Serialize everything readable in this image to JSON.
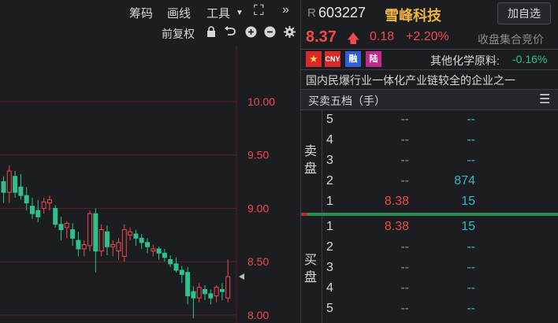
{
  "toolbar": {
    "chips": "筹码",
    "draw": "画线",
    "tools": "工具",
    "adjust": "前复权"
  },
  "stock": {
    "prefix": "R",
    "code": "603227",
    "name": "雪峰科技",
    "add_watch": "加自选",
    "price": "8.37",
    "change": "0.18",
    "change_pct": "+2.20%",
    "status": "收盘集合竞价",
    "sector_label": "其他化学原料:",
    "sector_change": "-0.16%",
    "tags": [
      "CNY",
      "融",
      "陆"
    ],
    "description": "国内民爆行业一体化产业链较全的企业之一"
  },
  "orderbook": {
    "title": "买卖五档（手）",
    "sell_label": [
      "卖",
      "盘"
    ],
    "buy_label": [
      "买",
      "盘"
    ],
    "sell": [
      {
        "level": "5",
        "price": "--",
        "vol": "--"
      },
      {
        "level": "4",
        "price": "--",
        "vol": "--"
      },
      {
        "level": "3",
        "price": "--",
        "vol": "--"
      },
      {
        "level": "2",
        "price": "--",
        "vol": "874"
      },
      {
        "level": "1",
        "price": "8.38",
        "vol": "15"
      }
    ],
    "buy": [
      {
        "level": "1",
        "price": "8.38",
        "vol": "15"
      },
      {
        "level": "2",
        "price": "--",
        "vol": "--"
      },
      {
        "level": "3",
        "price": "--",
        "vol": "--"
      },
      {
        "level": "4",
        "price": "--",
        "vol": "--"
      },
      {
        "level": "5",
        "price": "--",
        "vol": "--"
      }
    ]
  },
  "chart_data": {
    "type": "candlestick",
    "y_ticks": [
      "10.00",
      "9.50",
      "9.00",
      "8.50",
      "8.00"
    ],
    "ylim": [
      7.97,
      10.45
    ],
    "colors": {
      "up": "#f04a4a",
      "down": "#2fc08e",
      "grid": "#5a1e22",
      "axis": "#f04a4a"
    },
    "candles": [
      [
        9.25,
        9.3,
        9.15,
        9.05
      ],
      [
        9.15,
        9.4,
        9.35,
        9.05
      ],
      [
        9.3,
        9.35,
        9.15,
        9.1
      ],
      [
        9.2,
        9.32,
        9.12,
        9.08
      ],
      [
        9.12,
        9.2,
        9.05,
        8.98
      ],
      [
        9.02,
        9.1,
        8.95,
        8.9
      ],
      [
        8.98,
        9.08,
        8.92,
        8.87
      ],
      [
        9.0,
        9.1,
        9.06,
        8.95
      ],
      [
        9.05,
        9.12,
        9.08,
        8.98
      ],
      [
        9.0,
        9.03,
        8.85,
        8.82
      ],
      [
        8.85,
        8.92,
        8.8,
        8.7
      ],
      [
        8.82,
        8.88,
        8.86,
        8.72
      ],
      [
        8.8,
        8.86,
        8.72,
        8.65
      ],
      [
        8.7,
        8.78,
        8.62,
        8.55
      ],
      [
        8.62,
        8.7,
        8.66,
        8.55
      ],
      [
        8.65,
        8.98,
        8.95,
        8.6
      ],
      [
        8.95,
        9.0,
        8.6,
        8.4
      ],
      [
        8.6,
        8.85,
        8.8,
        8.55
      ],
      [
        8.78,
        8.84,
        8.64,
        8.56
      ],
      [
        8.64,
        8.7,
        8.66,
        8.55
      ],
      [
        8.6,
        8.72,
        8.68,
        8.52
      ],
      [
        8.55,
        8.85,
        8.8,
        8.5
      ],
      [
        8.75,
        8.82,
        8.78,
        8.7
      ],
      [
        8.76,
        8.8,
        8.72,
        8.65
      ],
      [
        8.72,
        8.76,
        8.68,
        8.62
      ],
      [
        8.68,
        8.72,
        8.64,
        8.58
      ],
      [
        8.6,
        8.66,
        8.62,
        8.55
      ],
      [
        8.62,
        8.64,
        8.58,
        8.52
      ],
      [
        8.58,
        8.62,
        8.54,
        8.5
      ],
      [
        8.52,
        8.56,
        8.48,
        8.45
      ],
      [
        8.48,
        8.54,
        8.42,
        8.4
      ],
      [
        8.42,
        8.46,
        8.38,
        8.3
      ],
      [
        8.4,
        8.45,
        8.18,
        8.1
      ],
      [
        8.22,
        8.27,
        8.16,
        7.97
      ],
      [
        8.16,
        8.3,
        8.26,
        8.12
      ],
      [
        8.24,
        8.28,
        8.2,
        8.14
      ],
      [
        8.2,
        8.24,
        8.16,
        8.1
      ],
      [
        8.18,
        8.28,
        8.26,
        8.12
      ],
      [
        8.24,
        8.3,
        8.22,
        8.14
      ],
      [
        8.16,
        8.52,
        8.36,
        8.12
      ]
    ]
  }
}
